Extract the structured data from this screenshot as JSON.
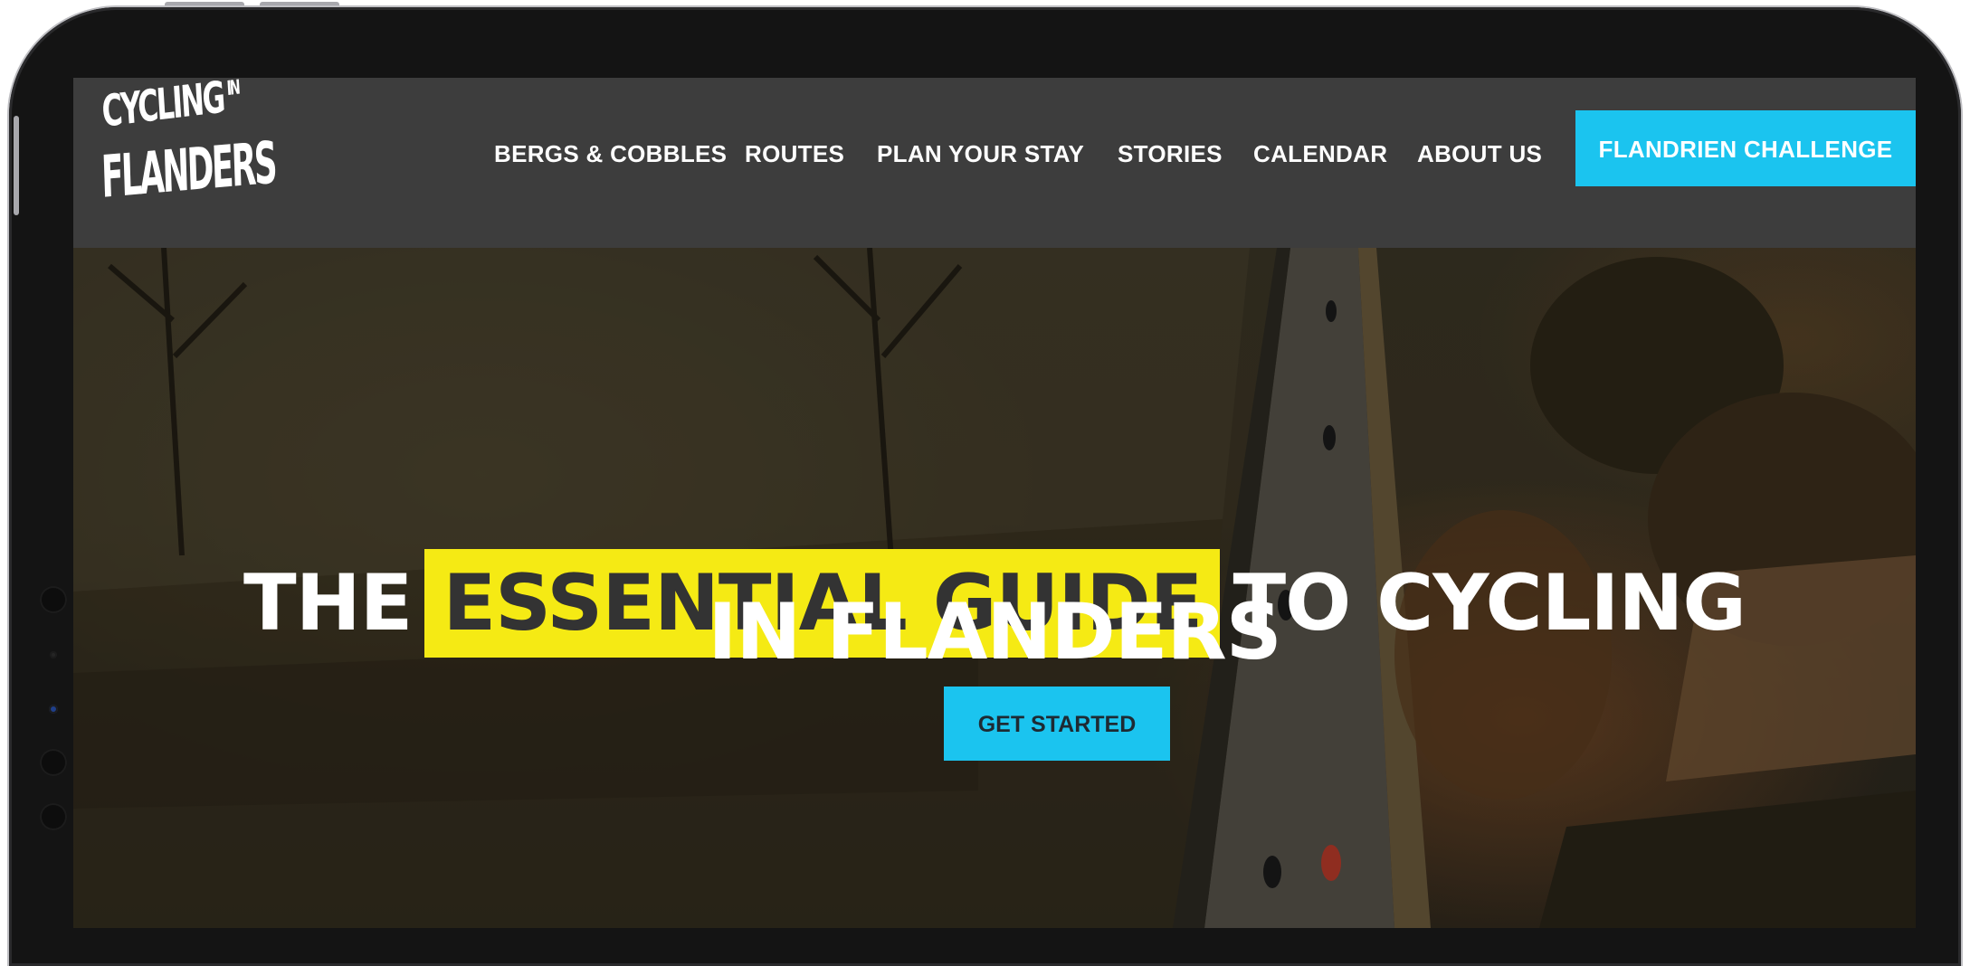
{
  "site": {
    "logo": {
      "line1": "CYCLING",
      "line1_small": "IN",
      "line2": "FLANDERS"
    }
  },
  "nav": {
    "items": [
      {
        "label": "BERGS & COBBLES"
      },
      {
        "label": "ROUTES"
      },
      {
        "label": "PLAN YOUR STAY"
      },
      {
        "label": "STORIES"
      },
      {
        "label": "CALENDAR"
      },
      {
        "label": "ABOUT US"
      }
    ],
    "cta_label": "FLANDRIEN CHALLENGE"
  },
  "hero": {
    "headline_prefix": "THE",
    "headline_highlight": "ESSENTIAL GUIDE",
    "headline_suffix": "TO CYCLING",
    "headline_line2": "IN FLANDERS",
    "cta_label": "GET STARTED"
  },
  "colors": {
    "header_bg": "#3d3d3d",
    "accent_cyan": "#1bc4ef",
    "highlight_yellow": "#f5ea14",
    "device_frame": "#141414"
  },
  "icons": [
    "logo-image"
  ]
}
